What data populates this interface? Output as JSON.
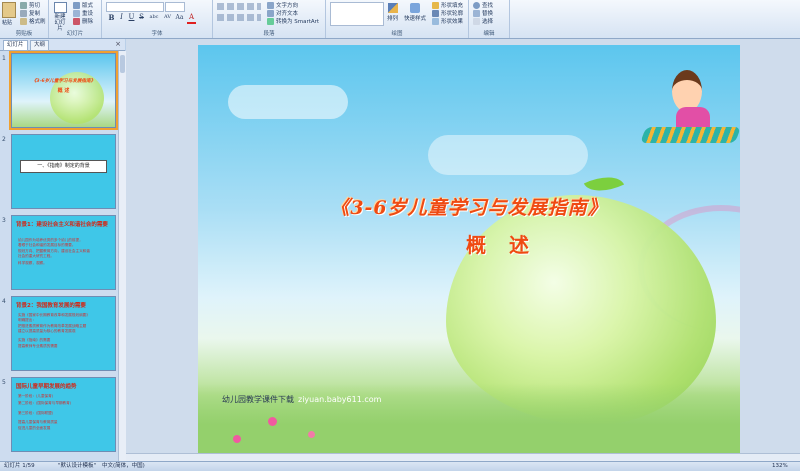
{
  "ribbon": {
    "clipboard": {
      "paste": "粘贴",
      "cut": "剪切",
      "copy": "复制",
      "format_painter": "格式刷",
      "label": "剪贴板"
    },
    "slides": {
      "new_slide": "新建幻灯片",
      "layout": "版式",
      "reset": "重设",
      "delete": "删除",
      "label": "幻灯片"
    },
    "font": {
      "label": "字体",
      "bold": "B",
      "italic": "I",
      "underline": "U",
      "strike": "S",
      "shadow": "abc",
      "spacing": "AV",
      "case": "Aa",
      "color": "A"
    },
    "paragraph": {
      "label": "段落",
      "text_direction": "文字方向",
      "align_text": "对齐文本",
      "convert_smartart": "转换为 SmartArt"
    },
    "drawing": {
      "label": "绘图",
      "arrange": "排列",
      "quick_styles": "快速样式",
      "shape_fill": "形状填充",
      "shape_outline": "形状轮廓",
      "shape_effects": "形状效果"
    },
    "editing": {
      "label": "编辑",
      "find": "查找",
      "replace": "替换",
      "select": "选择"
    }
  },
  "panel_tabs": {
    "slides": "幻灯片",
    "outline": "大纲",
    "close": "×"
  },
  "thumbnails": [
    {
      "num": "1",
      "title": "《3-6岁儿童学习与发展指南》",
      "subtitle": "概 述"
    },
    {
      "num": "2",
      "title": "一、《指南》制定的背景"
    },
    {
      "num": "3",
      "title": "背景1：建设社会主义和谐社会的需要",
      "lines": [
        "幼儿园作为培养优秀的多个幼儿的前提，",
        "着眼于社会和谐的发展目标的需要。",
        "规划方向、把握教育方向，建设社会主义和谐",
        "社会的重大研究工程。",
        "科学观察，观察。"
      ]
    },
    {
      "num": "4",
      "title": "背景2：我国教育发展的需要",
      "lines": [
        "实施《国家中长期教育改革和发展规划纲要》",
        "明确提出：",
        "把推进素质教育作为教育改革发展战略主题",
        "建立以提高质量为核心的教育发展观",
        "实施《指南》的需要",
        "提高教师专业素质的需要"
      ]
    },
    {
      "num": "5",
      "title": "国际儿童早期发展的趋势",
      "lines": [
        "第一阶段：(儿童保育)",
        "第二阶段：(国际保育与早期教育)",
        "第三阶段：(国际联盟)",
        "提高儿童保育与教育质量",
        "促进儿童的全面发展"
      ]
    }
  ],
  "slide": {
    "title_line1": "《3-6岁儿童学习与发展指南》",
    "title_line2": "概 述",
    "footer_label": "幼儿园教学课件下载",
    "footer_url": "ziyuan.baby611.com"
  },
  "status": {
    "slide_counter": "幻灯片 1/59",
    "theme": "\"默认设计模板\"",
    "language": "中文(简体，中国)",
    "zoom": "132%"
  }
}
